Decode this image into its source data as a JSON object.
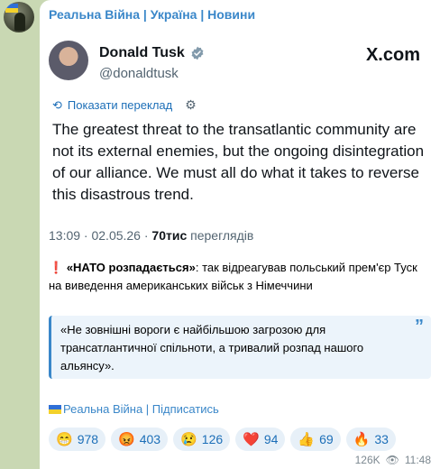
{
  "channel": {
    "name": "Реальна Війна | Україна | Новини"
  },
  "tweet": {
    "author_name": "Donald Tusk",
    "author_handle": "@donaldtusk",
    "source_label": "X.com",
    "translate_label": "Показати переклад",
    "text": "The greatest threat to the transatlantic community are not its external enemies, but the ongoing disintegration of our alliance. We must all do what it takes to reverse this disastrous trend.",
    "time_date": "13:09 · 02.05.26 · ",
    "views_count": "70тис",
    "views_label": " переглядів"
  },
  "post": {
    "mark": "❗",
    "headline": "«НАТО розпадається»",
    "body": ": так відреагував польський прем'єр Туск на виведення американських військ з Німеччини"
  },
  "quote": {
    "text": "«Не зовнішні вороги є найбільшою загрозою для трансатлантичної спільноти, а тривалий розпад нашого альянсу»."
  },
  "subscribe": {
    "label": "Реальна Війна | Підписатись"
  },
  "reactions": [
    {
      "icon": "😁",
      "count": "978"
    },
    {
      "icon": "😡",
      "count": "403"
    },
    {
      "icon": "😢",
      "count": "126"
    },
    {
      "icon": "❤️",
      "count": "94"
    },
    {
      "icon": "👍",
      "count": "69"
    },
    {
      "icon": "🔥",
      "count": "33"
    }
  ],
  "footer": {
    "views": "126K",
    "time": "11:48"
  },
  "colors": {
    "accent": "#3a87c9",
    "background": "#c9d8b3",
    "quote_bg": "#ecf4fb"
  }
}
